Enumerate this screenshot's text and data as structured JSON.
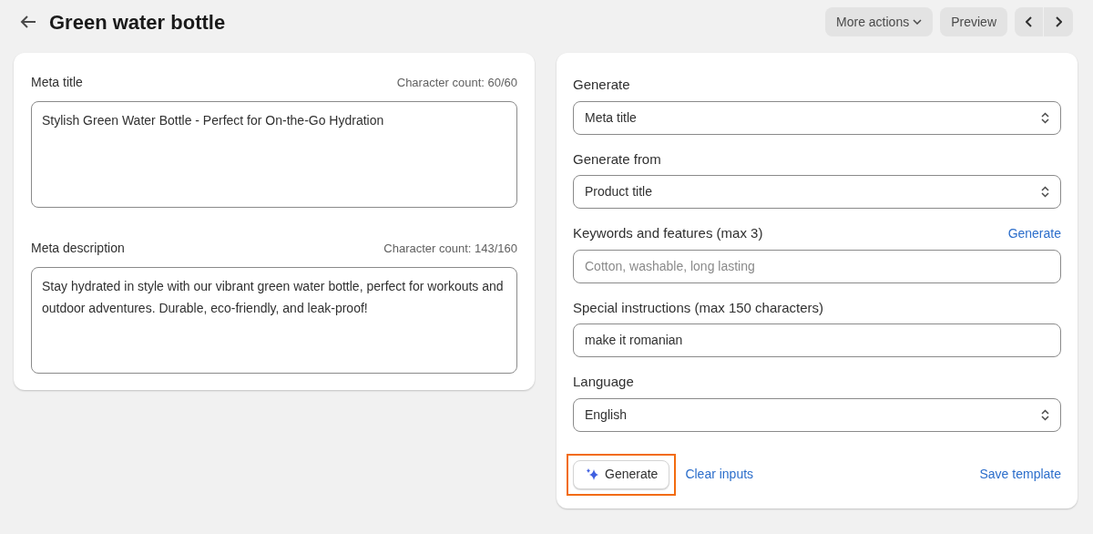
{
  "header": {
    "title": "Green water bottle",
    "buttons": [
      "More actions",
      "Preview"
    ]
  },
  "meta_fields": [
    {
      "label": "Meta title",
      "count": "Character count: 60/60",
      "value": "Stylish Green Water Bottle - Perfect for On-the-Go Hydration"
    },
    {
      "label": "Meta description",
      "count": "Character count: 143/160",
      "value": "Stay hydrated in style with our vibrant green water bottle, perfect for workouts and outdoor adventures. Durable, eco-friendly, and leak-proof!"
    }
  ],
  "generator_fields": [
    {
      "kind": "select",
      "label": "Generate",
      "value": "Meta title"
    },
    {
      "kind": "select",
      "label": "Generate from",
      "value": "Product title"
    },
    {
      "kind": "text",
      "label": "Keywords and features (max 3)",
      "link": "Generate",
      "placeholder": "Cotton, washable, long lasting"
    },
    {
      "kind": "text",
      "label": "Special instructions (max 150 characters)",
      "value": "make it romanian"
    },
    {
      "kind": "select",
      "label": "Language",
      "value": "English"
    }
  ],
  "actions": {
    "generate": {
      "label": "Generate",
      "highlighted": true
    },
    "clear": "Clear inputs",
    "save": "Save template"
  }
}
